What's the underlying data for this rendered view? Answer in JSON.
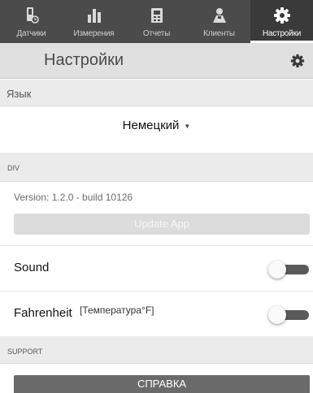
{
  "colors": {
    "tabbar": "#4b4b4b",
    "header": "#e0e0e0",
    "section": "#ebebeb",
    "toggle_track": "#5a5a5a"
  },
  "tabs": [
    {
      "label": "Датчики",
      "icon": "sensor-icon",
      "active": false
    },
    {
      "label": "Измерения",
      "icon": "bar-chart-icon",
      "active": false
    },
    {
      "label": "Отчеты",
      "icon": "report-icon",
      "active": false
    },
    {
      "label": "Клиенты",
      "icon": "clients-icon",
      "active": false
    },
    {
      "label": "Настройки",
      "icon": "gear-icon",
      "active": true
    }
  ],
  "header": {
    "title": "Настройки",
    "icon": "gear-icon"
  },
  "language": {
    "section_label": "Язык",
    "selected": "Немецкий"
  },
  "div_section": {
    "label": "DIV",
    "version": "Version: 1.2.0 - build 10126",
    "update_label": "Update App"
  },
  "settings": {
    "sound": {
      "label": "Sound",
      "enabled": false
    },
    "fahrenheit": {
      "label": "Fahrenheit",
      "sublabel": "[Температура°F]",
      "enabled": false
    }
  },
  "support": {
    "label": "SUPPORT",
    "help_label": "СПРАВКА"
  }
}
